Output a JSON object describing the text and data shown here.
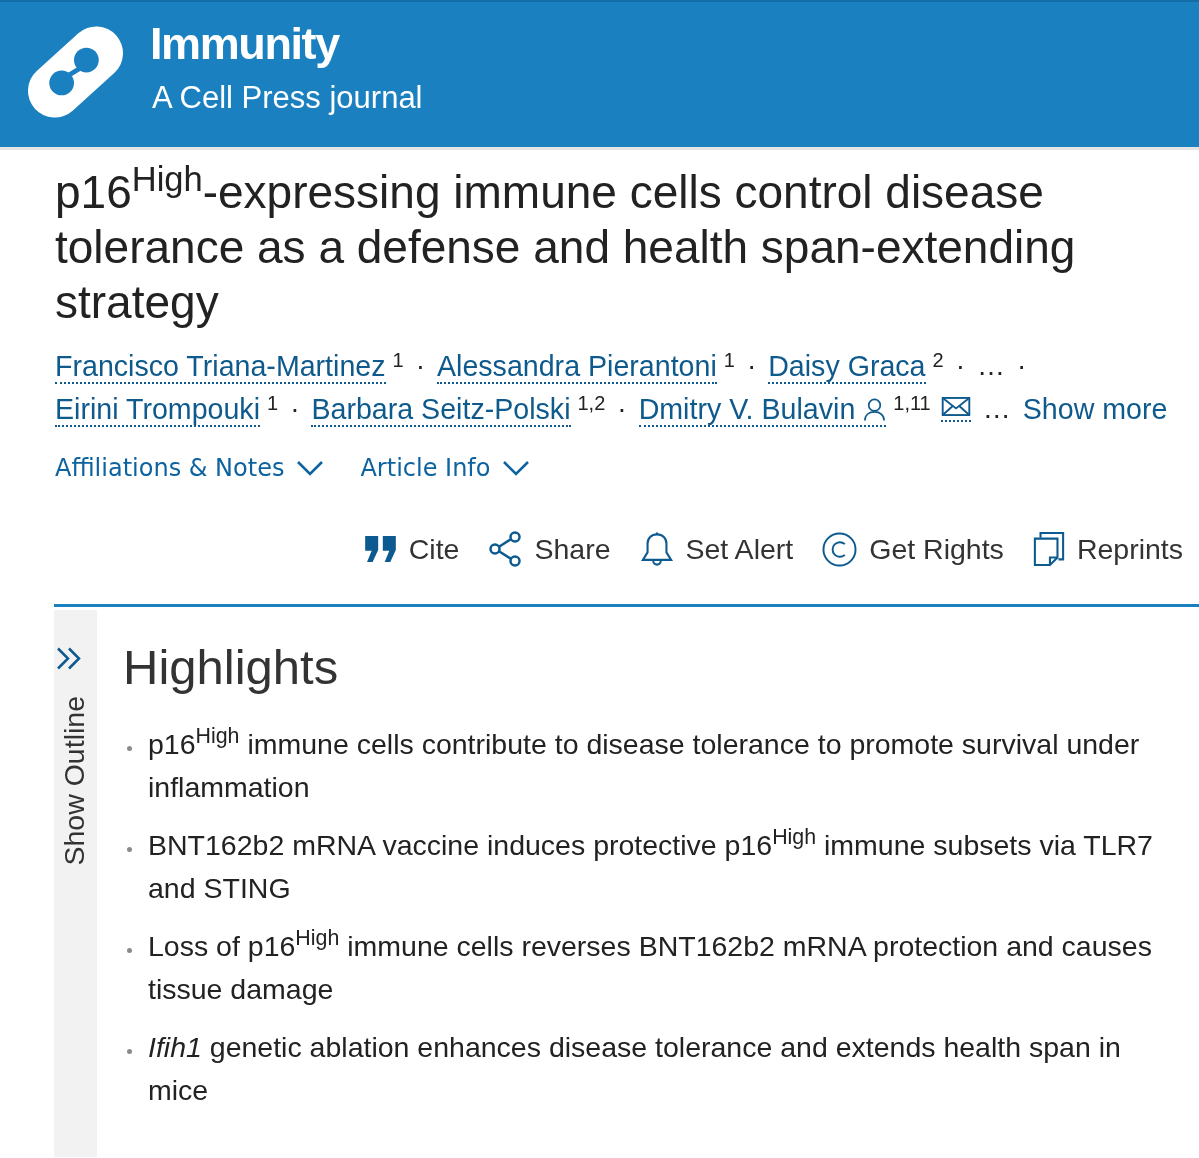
{
  "header": {
    "journal": "Immunity",
    "tagline": "A Cell Press journal"
  },
  "article": {
    "title": "p16$^{High}$-expressing immune cells control disease tolerance as a defense and health span-extending strategy",
    "authors": [
      {
        "kind": "author",
        "name": "Francisco Triana-Martinez",
        "affiliations": "1",
        "corresponding": false
      },
      {
        "kind": "separator",
        "text": "·"
      },
      {
        "kind": "author",
        "name": "Alessandra Pierantoni",
        "affiliations": "1",
        "corresponding": false
      },
      {
        "kind": "separator",
        "text": "·"
      },
      {
        "kind": "author",
        "name": "Daisy Graca",
        "affiliations": "2",
        "corresponding": false
      },
      {
        "kind": "separator",
        "text": "·"
      },
      {
        "kind": "ellipsis",
        "text": "…"
      },
      {
        "kind": "separator",
        "text": "·"
      },
      {
        "kind": "author",
        "name": "Eirini Trompouki",
        "affiliations": "1",
        "corresponding": false
      },
      {
        "kind": "separator",
        "text": "·"
      },
      {
        "kind": "author",
        "name": "Barbara Seitz-Polski",
        "affiliations": "1,2",
        "corresponding": false
      },
      {
        "kind": "separator",
        "text": "·"
      },
      {
        "kind": "author",
        "name": "Dmitry V. Bulavin",
        "affiliations": "1,11",
        "corresponding": true
      },
      {
        "kind": "ellipsis",
        "text": "…"
      },
      {
        "kind": "link",
        "text": "Show more"
      }
    ],
    "disclosures": [
      {
        "label": "Affiliations & Notes",
        "expanded": false
      },
      {
        "label": "Article Info",
        "expanded": false
      }
    ],
    "actions": [
      {
        "label": "Cite"
      },
      {
        "label": "Share"
      },
      {
        "label": "Set Alert"
      },
      {
        "label": "Get Rights"
      },
      {
        "label": "Reprints"
      }
    ]
  },
  "outline_toggle": {
    "label": "Show Outline"
  },
  "highlights": {
    "heading": "Highlights",
    "items": [
      "p16$^{High}$ immune cells contribute to disease tolerance to promote survival under inflammation",
      "BNT162b2 mRNA vaccine induces protective p16$^{High}$ immune subsets via TLR7 and STING",
      "Loss of p16$^{High}$ immune cells reverses BNT162b2 mRNA protection and causes tissue damage",
      "*Ifih1* genetic ablation enhances disease tolerance and extends health span in mice"
    ]
  }
}
